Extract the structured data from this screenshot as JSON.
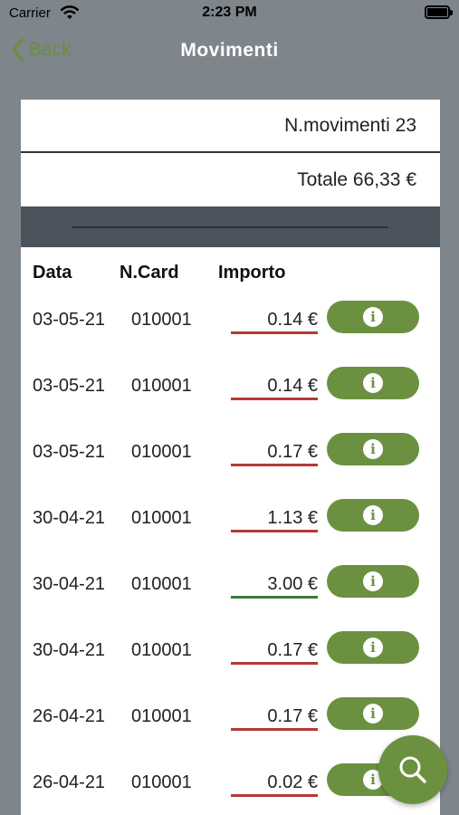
{
  "status_bar": {
    "carrier": "Carrier",
    "time": "2:23 PM"
  },
  "nav": {
    "back_label": "Back",
    "title": "Movimenti"
  },
  "summary": {
    "count_text": "N.movimenti 23",
    "total_text": "Totale 66,33 €"
  },
  "table": {
    "headers": {
      "date": "Data",
      "card": "N.Card",
      "amount": "Importo"
    },
    "rows": [
      {
        "date": "03-05-21",
        "card": "010001",
        "amount": "0.14 €",
        "positive": false
      },
      {
        "date": "03-05-21",
        "card": "010001",
        "amount": "0.14 €",
        "positive": false
      },
      {
        "date": "03-05-21",
        "card": "010001",
        "amount": "0.17 €",
        "positive": false
      },
      {
        "date": "30-04-21",
        "card": "010001",
        "amount": "1.13 €",
        "positive": false
      },
      {
        "date": "30-04-21",
        "card": "010001",
        "amount": "3.00 €",
        "positive": true
      },
      {
        "date": "30-04-21",
        "card": "010001",
        "amount": "0.17 €",
        "positive": false
      },
      {
        "date": "26-04-21",
        "card": "010001",
        "amount": "0.17 €",
        "positive": false
      },
      {
        "date": "26-04-21",
        "card": "010001",
        "amount": "0.02 €",
        "positive": false
      }
    ],
    "info_icon": "i"
  },
  "colors": {
    "accent": "#6b9140",
    "negative": "#b33a35",
    "positive": "#3a7a3a"
  }
}
